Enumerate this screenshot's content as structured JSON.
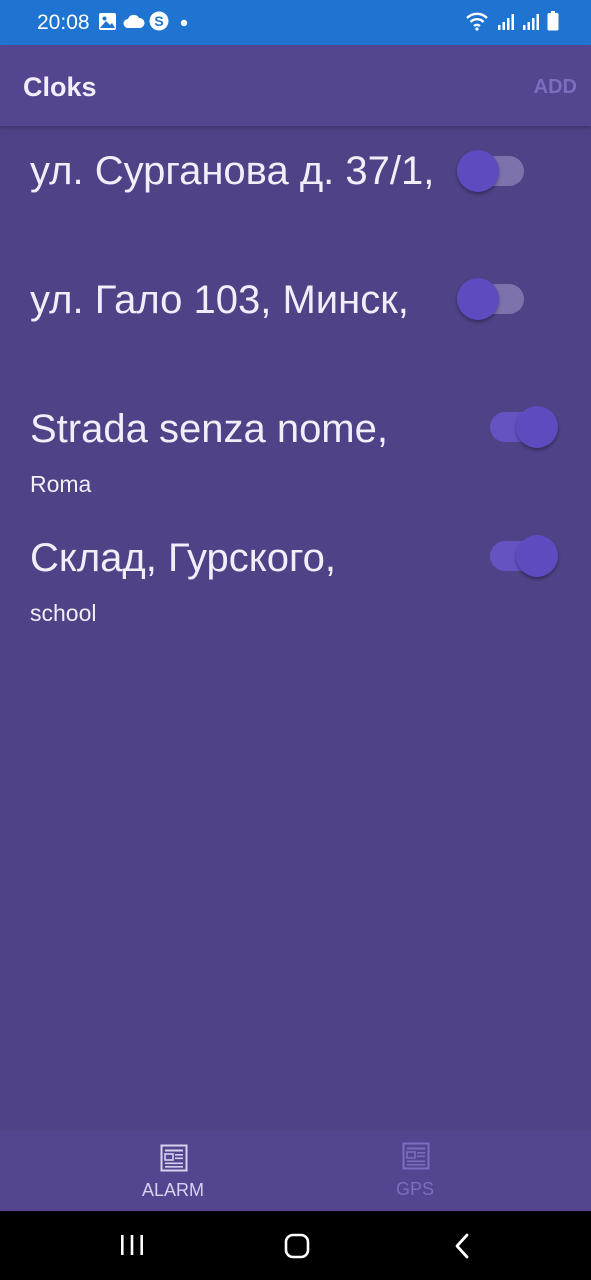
{
  "status_bar": {
    "time": "20:08",
    "left_icons": [
      "gallery-icon",
      "cloud-icon",
      "skype-icon",
      "dot-icon"
    ],
    "right_icons": [
      "wifi-icon",
      "signal-icon",
      "signal-icon",
      "battery-icon"
    ]
  },
  "app_bar": {
    "title": "Cloks",
    "add_label": "ADD"
  },
  "alarms": [
    {
      "title": "ул. Сурганова д. 37/1,",
      "subtitle": "",
      "enabled": false
    },
    {
      "title": "ул. Гало 103, Минск,",
      "subtitle": "",
      "enabled": false
    },
    {
      "title": "Strada senza nome,",
      "subtitle": "Roma",
      "enabled": true
    },
    {
      "title": "Склад, Гурского,",
      "subtitle": "school",
      "enabled": true
    }
  ],
  "bottom_nav": {
    "tabs": [
      {
        "label": "ALARM",
        "icon": "newspaper-icon",
        "selected": true
      },
      {
        "label": "GPS",
        "icon": "newspaper-icon",
        "selected": false
      }
    ]
  },
  "system_nav": {
    "buttons": [
      "recent-apps-icon",
      "home-icon",
      "back-icon"
    ]
  },
  "colors": {
    "status_bar": "#1f73d1",
    "background": "#4f4286",
    "app_bar": "#55448f",
    "accent": "#5e4bbf",
    "text": "#f1eef9",
    "selected_tab": "#d8d2ef",
    "unselected_tab": "#7c6dbf"
  }
}
